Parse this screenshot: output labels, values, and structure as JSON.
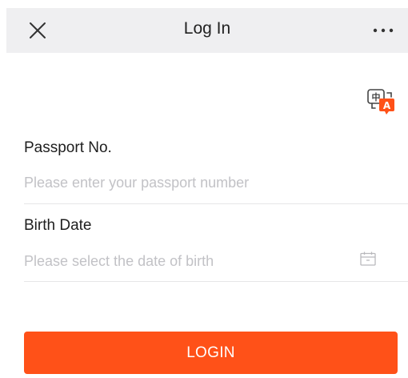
{
  "header": {
    "title": "Log In"
  },
  "language_switch": {
    "badge_zh": "中",
    "badge_en": "A"
  },
  "form": {
    "passport_label": "Passport No.",
    "passport_placeholder": "Please enter your passport number",
    "passport_value": "",
    "birth_label": "Birth Date",
    "birth_placeholder": "Please select the date of birth",
    "birth_value": ""
  },
  "login_button_label": "LOGIN",
  "icons": {
    "close": "close-icon",
    "more": "more-horizontal-icon",
    "language": "language-switch-icon",
    "calendar": "calendar-icon"
  },
  "colors": {
    "accent": "#ff5118",
    "header_background": "#efeff1",
    "placeholder": "#c2c2c6",
    "text": "#1e1e1e"
  }
}
